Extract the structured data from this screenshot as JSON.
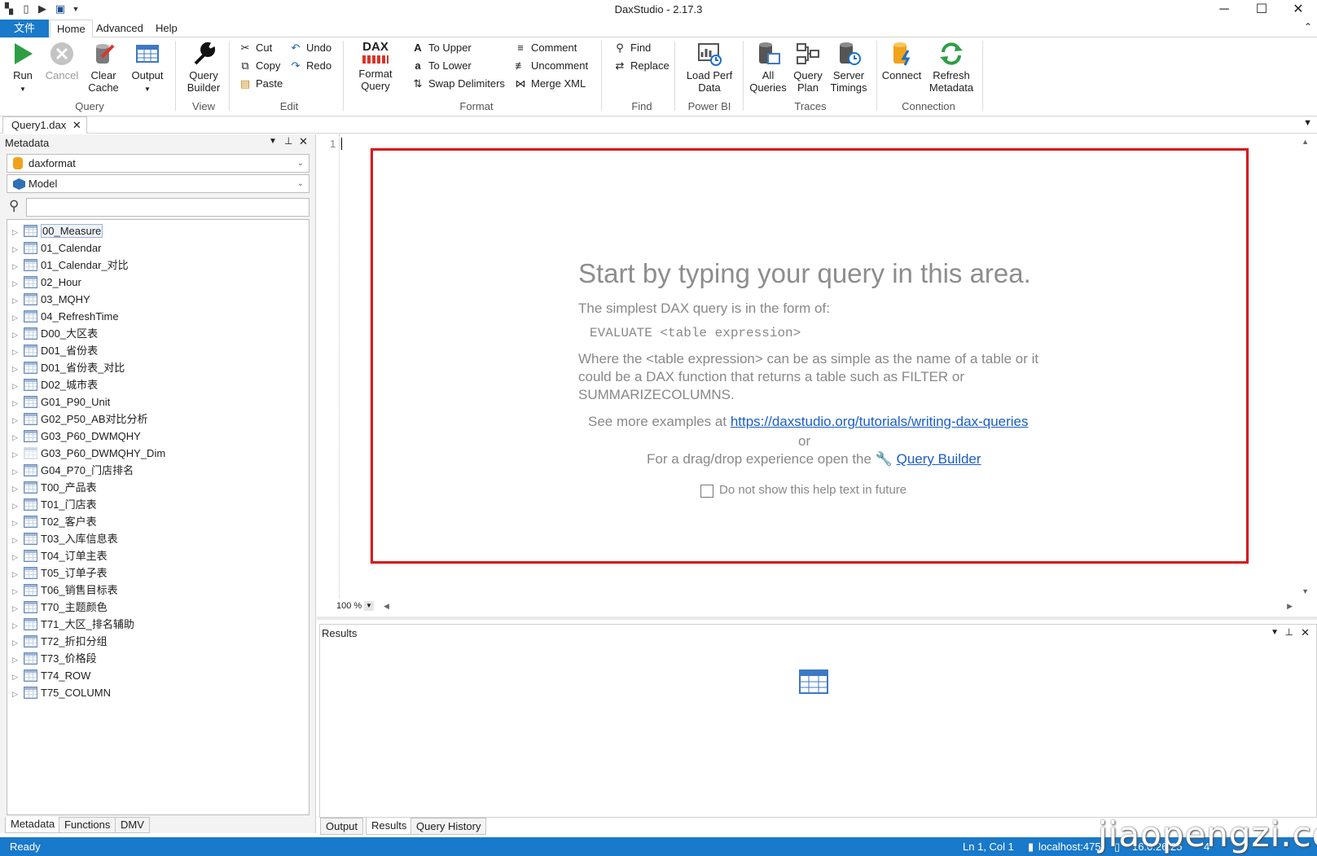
{
  "app": {
    "title": "DaxStudio - 2.17.3"
  },
  "menu": {
    "file": "文件",
    "home": "Home",
    "advanced": "Advanced",
    "help": "Help"
  },
  "ribbon": {
    "query": {
      "run": "Run",
      "cancel": "Cancel",
      "clear_cache": "Clear Cache",
      "output": "Output",
      "group": "Query"
    },
    "view": {
      "query_builder": "Query Builder",
      "group": "View"
    },
    "edit": {
      "cut": "Cut",
      "copy": "Copy",
      "paste": "Paste",
      "undo": "Undo",
      "redo": "Redo",
      "group": "Edit"
    },
    "format": {
      "format_query": "Format Query",
      "to_upper": "To Upper",
      "to_lower": "To Lower",
      "swap_delimiters": "Swap Delimiters",
      "comment": "Comment",
      "uncomment": "Uncomment",
      "merge_xml": "Merge XML",
      "group": "Format",
      "dax_logo": "DAX"
    },
    "find": {
      "find": "Find",
      "replace": "Replace",
      "group": "Find"
    },
    "powerbi": {
      "load_perf_data": "Load Perf Data",
      "group": "Power BI"
    },
    "traces": {
      "all_queries": "All Queries",
      "query_plan": "Query Plan",
      "server_timings": "Server Timings",
      "group": "Traces"
    },
    "connection": {
      "connect": "Connect",
      "refresh_metadata": "Refresh Metadata",
      "group": "Connection"
    }
  },
  "document_tab": {
    "label": "Query1.dax"
  },
  "metadata_panel": {
    "title": "Metadata",
    "database": "daxformat",
    "model": "Model",
    "search_value": "",
    "tables": [
      "00_Measure",
      "01_Calendar",
      "01_Calendar_对比",
      "02_Hour",
      "03_MQHY",
      "04_RefreshTime",
      "D00_大区表",
      "D01_省份表",
      "D01_省份表_对比",
      "D02_城市表",
      "G01_P90_Unit",
      "G02_P50_AB对比分析",
      "G03_P60_DWMQHY",
      "G03_P60_DWMQHY_Dim",
      "G04_P70_门店排名",
      "T00_产品表",
      "T01_门店表",
      "T02_客户表",
      "T03_入库信息表",
      "T04_订单主表",
      "T05_订单子表",
      "T06_销售目标表",
      "T70_主题颜色",
      "T71_大区_排名辅助",
      "T72_折扣分组",
      "T73_价格段",
      "T74_ROW",
      "T75_COLUMN"
    ],
    "tabs": {
      "metadata": "Metadata",
      "functions": "Functions",
      "dmv": "DMV"
    }
  },
  "editor": {
    "line_number": "1",
    "zoom": "100 %",
    "help": {
      "heading": "Start by typing your query in this area.",
      "line1": "The simplest DAX query is in the form of:",
      "code": "EVALUATE <table expression>",
      "para1": "Where the <table expression> can be as simple as the name of a table or it",
      "para2": "could be a DAX function that returns a table such as FILTER or",
      "para3": "SUMMARIZECOLUMNS.",
      "see_more": "See more examples at",
      "link": "https://daxstudio.org/tutorials/writing-dax-queries",
      "or": "or",
      "dragdrop": "For a drag/drop experience open the",
      "query_builder_link": "Query Builder",
      "checkbox_label": "Do not show this help text in future",
      "checkbox_checked": false
    }
  },
  "results_panel": {
    "title": "Results"
  },
  "output_tabs": {
    "output": "Output",
    "results": "Results",
    "history": "Query History"
  },
  "statusbar": {
    "status": "Ready",
    "position": "Ln 1, Col 1",
    "server": "localhost:475",
    "version": "16.0.26.25",
    "users": "4"
  },
  "watermark": "jiaopengzi.com",
  "colors": {
    "accent": "#1979ca",
    "highlight_box": "#d81b1b",
    "run_green": "#2e9e45"
  }
}
